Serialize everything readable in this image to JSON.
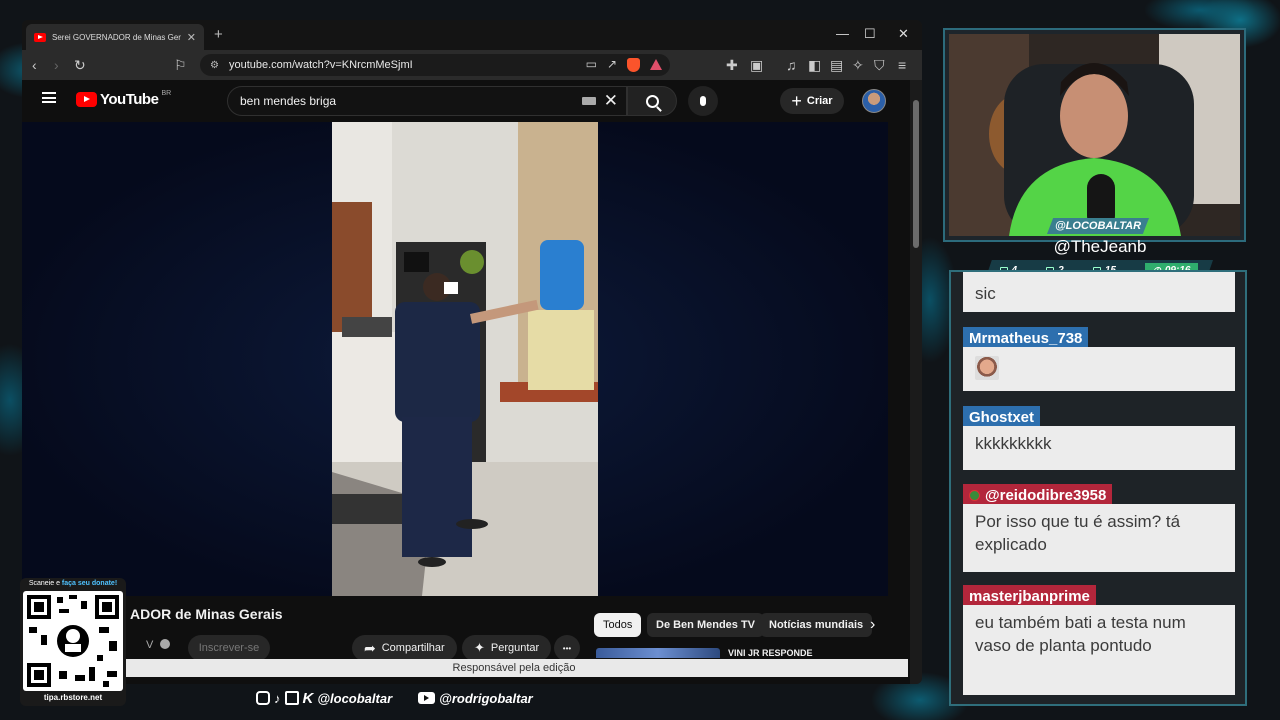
{
  "browser": {
    "tab_title": "Serei GOVERNADOR de Minas Gerais",
    "url": "youtube.com/watch?v=KNrcmMeSjmI",
    "brave_badge": "99+"
  },
  "youtube": {
    "logo_text": "YouTube",
    "region": "BR",
    "search_value": "ben mendes briga",
    "create_label": "Criar",
    "video_title": "ADOR de Minas Gerais",
    "channel_suffix": "V",
    "subscribe_label": "Inscrever-se",
    "share_label": "Compartilhar",
    "ask_label": "Perguntar",
    "more_label": "•••",
    "chips": [
      "Todos",
      "De Ben Mendes TV",
      "Notícias mundiais"
    ],
    "editor_notice": "Responsável pela edição",
    "rec_title": "VINI JR RESPONDE"
  },
  "overlay": {
    "streamer_tag": "@LOCOBALTAR",
    "viewer_name": "@TheJeanb",
    "stats": {
      "viewers_a": "4",
      "viewers_b": "2",
      "viewers_c": "15",
      "time": "09:16"
    },
    "qr_header_prefix": "Scaneie e ",
    "qr_header_link": "faça seu donate!",
    "qr_footer": "tipa.rbstore.net",
    "social_1": "@locobaltar",
    "social_2": "@rodrigobaltar"
  },
  "chat": {
    "partial_message": "sic",
    "messages": [
      {
        "user": "Mrmatheus_738",
        "text": "",
        "color": "#2d6fae",
        "emote": true
      },
      {
        "user": "Ghostxet",
        "text": "kkkkkkkkk",
        "color": "#2d6fae"
      },
      {
        "user": "@reidodibre3958",
        "text": "Por isso que tu é assim? tá explicado",
        "color": "#b3263b"
      },
      {
        "user": "masterjbanprime",
        "text": "eu também bati a testa num vaso de planta pontudo",
        "color": "#b3263b"
      }
    ]
  },
  "colors": {
    "accent_teal": "#2f6e7b",
    "youtube_red": "#ff0000",
    "chat_blue": "#2d6fae",
    "chat_red": "#b3263b",
    "timer_green": "#2fae6d"
  }
}
